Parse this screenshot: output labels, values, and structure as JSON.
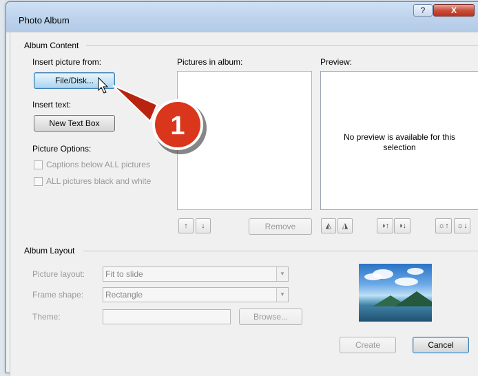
{
  "window": {
    "title": "Photo Album",
    "help_glyph": "?",
    "close_glyph": "X"
  },
  "album_content": {
    "group_label": "Album Content",
    "insert_picture_label": "Insert picture from:",
    "file_disk_button": "File/Disk...",
    "insert_text_label": "Insert text:",
    "new_text_box_button": "New Text Box",
    "picture_options_label": "Picture Options:",
    "captions_checkbox": "Captions below ALL pictures",
    "black_white_checkbox": "ALL pictures black and white",
    "pictures_in_album_label": "Pictures in album:",
    "preview_label": "Preview:",
    "preview_message": "No preview is available for this selection",
    "move_up_glyph": "↑",
    "move_down_glyph": "↓",
    "remove_button": "Remove",
    "rotate_left_glyph": "◭",
    "rotate_right_glyph": "◮",
    "contrast_up_glyph": "◑↑",
    "contrast_down_glyph": "◑↓",
    "brightness_up_glyph": "☼↑",
    "brightness_down_glyph": "☼↓"
  },
  "album_layout": {
    "group_label": "Album Layout",
    "picture_layout_label": "Picture layout:",
    "picture_layout_value": "Fit to slide",
    "frame_shape_label": "Frame shape:",
    "frame_shape_value": "Rectangle",
    "theme_label": "Theme:",
    "theme_value": "",
    "browse_button": "Browse..."
  },
  "footer": {
    "create_button": "Create",
    "cancel_button": "Cancel"
  },
  "callout": {
    "number": "1",
    "color": "#d9361b"
  },
  "colors": {
    "title_bar": "#bcd2ec",
    "close_button": "#c9503e",
    "focus_blue": "#3c7fb1"
  },
  "icons": [
    "help-icon",
    "close-icon",
    "mouse-cursor-icon",
    "chevron-down-icon"
  ]
}
